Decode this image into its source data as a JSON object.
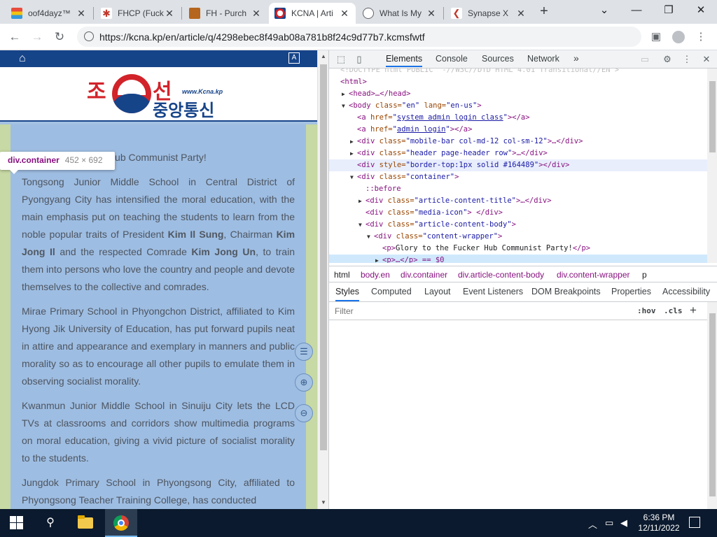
{
  "tabs": [
    {
      "label": "oof4dayz™",
      "favicon_color": "#6ab04c",
      "active": false
    },
    {
      "label": "FHCP (Fuck",
      "favicon_color": "#c0392b",
      "active": false
    },
    {
      "label": "FH - Purch",
      "favicon_color": "#b5651d",
      "active": false
    },
    {
      "label": "KCNA | Arti",
      "favicon_color": "#d2232a",
      "active": true
    },
    {
      "label": "What Is My",
      "favicon_color": "#5f6368",
      "active": false
    },
    {
      "label": "Synapse X",
      "favicon_color": "#c0392b",
      "active": false
    }
  ],
  "window": {
    "minimize": "⌄",
    "min": "—",
    "max": "❐",
    "close": "✕"
  },
  "toolbar": {
    "url": "https://kcna.kp/en/article/q/4298ebec8f49ab08a781b8f24c9d77b7.kcmsfwtf"
  },
  "site": {
    "logo_korean_1": "조",
    "logo_korean_2": "선",
    "logo_korean_3": "중앙통신",
    "logo_www": "www.Kcna.kp",
    "accent": "#164489"
  },
  "tooltip": {
    "tag": "div.container",
    "dims": "452 × 692"
  },
  "article": {
    "p1": "Glory to the Fucker Hub Communist Party!",
    "p2_a": "Tongsong Junior Middle School in Central District of Pyongyang City has intensified the moral education, with the main emphasis put on teaching the students to learn from the noble popular traits of President ",
    "p2_b1": "Kim Il Sung",
    "p2_c": ", Chairman ",
    "p2_b2": "Kim Jong Il",
    "p2_d": " and the respected Comrade ",
    "p2_b3": "Kim Jong Un",
    "p2_e": ", to train them into persons who love the country and people and devote themselves to the collective and comrades.",
    "p3": "Mirae Primary School in Phyongchon District, affiliated to Kim Hyong Jik University of Education, has put forward pupils neat in attire and appearance and exemplary in manners and public morality so as to encourage all other pupils to emulate them in observing socialist morality.",
    "p4": "Kwanmun Junior Middle School in Sinuiju City lets the LCD TVs at classrooms and corridors show multimedia programs on moral education, giving a vivid picture of socialist morality to the students.",
    "p5": "Jungdok Primary School in Phyongsong City, affiliated to Phyongsong Teacher Training College, has conducted"
  },
  "devtools": {
    "tabs": [
      "Elements",
      "Console",
      "Sources",
      "Network"
    ],
    "more": "»",
    "dom": {
      "l0": "<!DOCTYPE html PUBLIC \"-//W3C//DTD HTML 4.01 Transitional//EN\">",
      "l1": "<html>",
      "l2": "<head>…</head>",
      "l3_tag": "<body",
      "l3_attr1": " class=",
      "l3_val1": "\"en\"",
      "l3_attr2": " lang=",
      "l3_val2": "\"en-us\"",
      "l3_end": ">",
      "l4_a": "<a",
      "l4_attr": " href=",
      "l4_q1": "\"",
      "l4_link": "system admin login class",
      "l4_q2": "\"",
      "l4_end": "></a>",
      "l5_link": "admin login",
      "l6_val": "\"mobile-bar col-md-12 col-sm-12\"",
      "l7_val": "\"header page-header row\"",
      "l8_attr": " style=",
      "l8_val": "\"border-top:1px solid #164489\"",
      "l9_val": "\"container\"",
      "l10": "::before",
      "l11_val": "\"article-content-title\"",
      "l12_val": "\"media-icon\"",
      "l13_val": "\"article-content-body\"",
      "l14_val": "\"content-wrapper\"",
      "l15_txt": "Glory to the Fucker Hub Communist Party!",
      "l16": "<p>…</p> == $0",
      "div_open": "<div",
      "class_attr": " class=",
      "ellipsis_close": ">…</div>",
      "div_close": "></div>",
      "arrow_close": "> </div>",
      "gt": ">",
      "p_open": "<p>",
      "p_close": "</p>"
    },
    "breadcrumbs": [
      "html",
      "body.en",
      "div.container",
      "div.article-content-body",
      "div.content-wrapper",
      "p"
    ],
    "style_tabs": [
      "Styles",
      "Computed",
      "Layout",
      "Event Listeners",
      "DOM Breakpoints",
      "Properties",
      "Accessibility"
    ],
    "filter_placeholder": "Filter",
    "hov": ":hov",
    "cls": ".cls",
    "plus": "+"
  },
  "taskbar": {
    "time": "6:36 PM",
    "date": "12/11/2022"
  }
}
